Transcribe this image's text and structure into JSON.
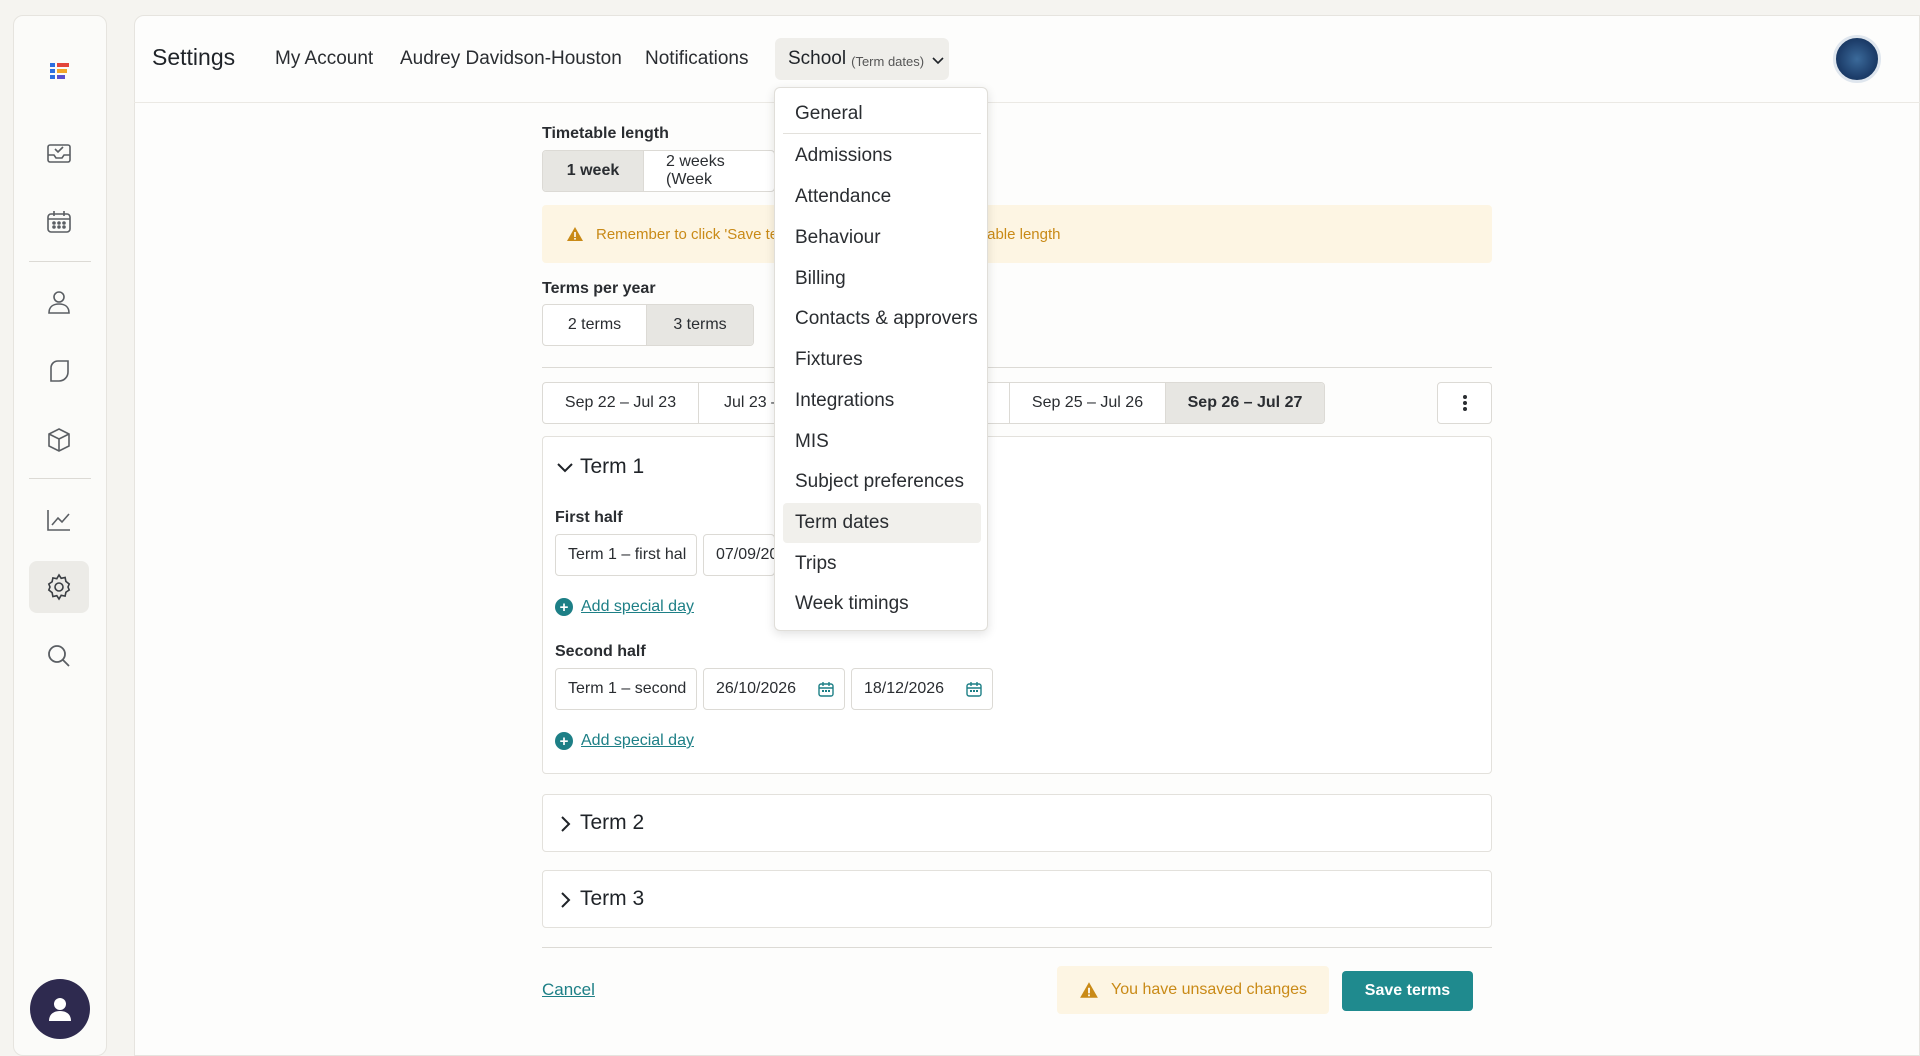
{
  "header": {
    "title": "Settings",
    "nav": [
      "My Account",
      "Audrey Davidson-Houston",
      "Notifications"
    ],
    "school_tab": {
      "label": "School",
      "sub": "(Term dates)"
    }
  },
  "timetable": {
    "label": "Timetable length",
    "options": [
      "1 week",
      "2 weeks (Week"
    ],
    "selected": "1 week"
  },
  "warning": {
    "text_left": "Remember to click 'Save te",
    "text_right": "able length"
  },
  "terms_per_year": {
    "label": "Terms per year",
    "options": [
      "2 terms",
      "3 terms"
    ],
    "selected": "3 terms"
  },
  "years": [
    "Sep 22 – Jul 23",
    "Jul 23 –",
    "",
    "Sep 25 – Jul 26",
    "Sep 26 – Jul 27"
  ],
  "term1": {
    "title": "Term 1",
    "first_half_label": "First half",
    "first_name": "Term 1 – first hal",
    "first_start": "07/09/20",
    "second_half_label": "Second half",
    "second_name": "Term 1 – second",
    "second_start": "26/10/2026",
    "second_end": "18/12/2026",
    "add_special": "Add special day"
  },
  "term2": {
    "title": "Term 2"
  },
  "term3": {
    "title": "Term 3"
  },
  "footer": {
    "cancel": "Cancel",
    "unsaved": "You have unsaved changes",
    "save": "Save terms"
  },
  "dropdown": {
    "items": [
      "General",
      "Admissions",
      "Attendance",
      "Behaviour",
      "Billing",
      "Contacts & approvers",
      "Fixtures",
      "Integrations",
      "MIS",
      "Subject preferences",
      "Term dates",
      "Trips",
      "Week timings"
    ],
    "highlighted": "Term dates"
  },
  "colors": {
    "accent": "#1f8a8e",
    "warning": "#c98a17",
    "warning_bg": "#fdf5e3"
  }
}
